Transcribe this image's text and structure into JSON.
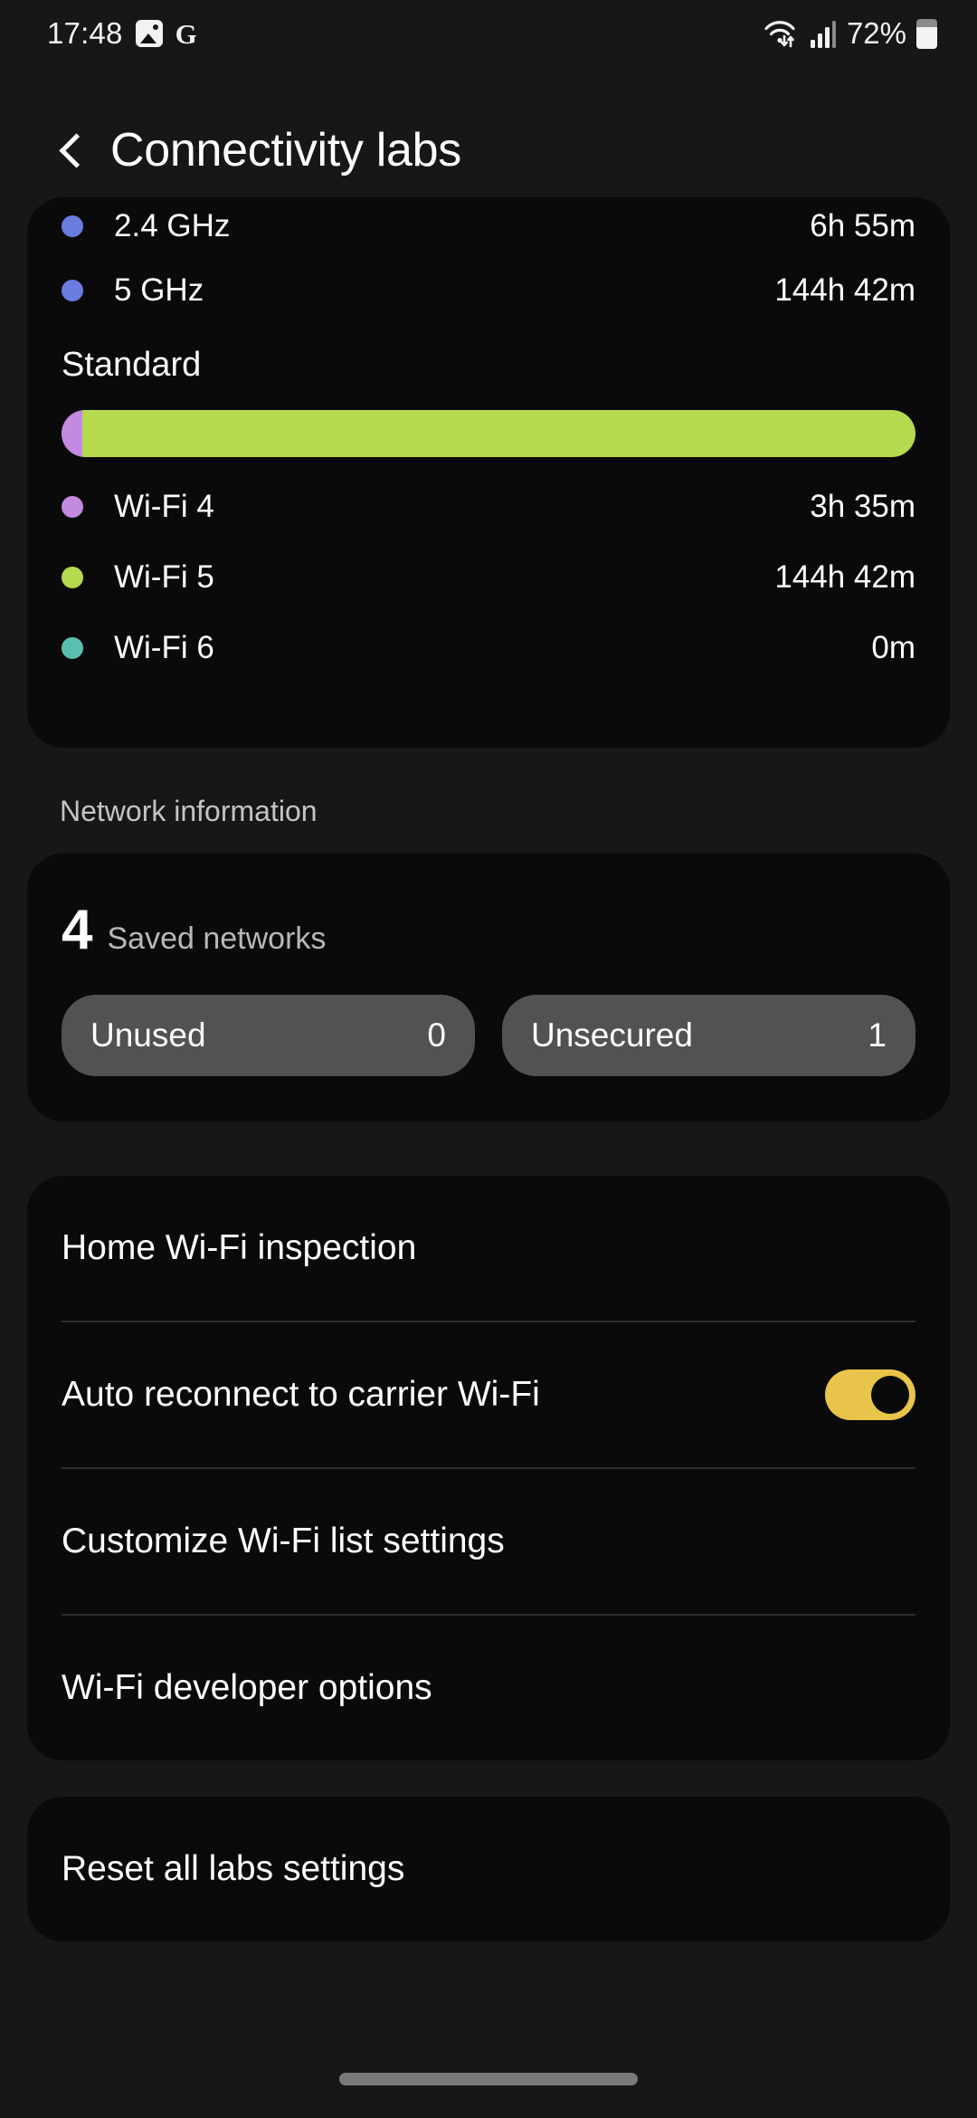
{
  "status_bar": {
    "time": "17:48",
    "gallery_icon": "image-icon",
    "google_icon": "G",
    "wifi_icon": "wifi-transfer-icon",
    "signal_icon": "cellular-signal-icon",
    "battery_percent": "72%",
    "battery_icon": "battery-icon"
  },
  "header": {
    "back_icon": "back-chevron-icon",
    "title": "Connectivity labs"
  },
  "usage_card": {
    "clipped_row": {
      "label": "2.4 GHz",
      "value": "6h 55m",
      "color": "#6b7ce0"
    },
    "bands": [
      {
        "label": "5 GHz",
        "value": "144h 42m",
        "color": "#6b7ce0"
      }
    ],
    "standard_label": "Standard",
    "standards": [
      {
        "label": "Wi-Fi 4",
        "value": "3h 35m",
        "color": "#c489e0",
        "percent": 2.4
      },
      {
        "label": "Wi-Fi 5",
        "value": "144h 42m",
        "color": "#b5d94f",
        "percent": 97.6
      },
      {
        "label": "Wi-Fi 6",
        "value": "0m",
        "color": "#5bbfb0",
        "percent": 0
      }
    ]
  },
  "network_information": {
    "heading": "Network information",
    "saved_count": "4",
    "saved_label": "Saved networks",
    "chips": [
      {
        "label": "Unused",
        "value": "0"
      },
      {
        "label": "Unsecured",
        "value": "1"
      }
    ]
  },
  "settings_list": [
    {
      "label": "Home Wi-Fi inspection",
      "has_toggle": false
    },
    {
      "label": "Auto reconnect to carrier Wi-Fi",
      "has_toggle": true,
      "toggle_on": true
    },
    {
      "label": "Customize Wi-Fi list settings",
      "has_toggle": false
    },
    {
      "label": "Wi-Fi developer options",
      "has_toggle": false
    }
  ],
  "reset": {
    "label": "Reset all labs settings"
  },
  "nav_bar": {
    "home_pill": "home-gesture-bar"
  },
  "colors": {
    "page_background": "#171717",
    "card_background": "#0a0a0a",
    "chip_background": "#525252",
    "toggle_on": "#e8c44a",
    "band_5ghz": "#6b7ce0",
    "wifi4": "#c489e0",
    "wifi5": "#b5d94f",
    "wifi6": "#5bbfb0"
  }
}
